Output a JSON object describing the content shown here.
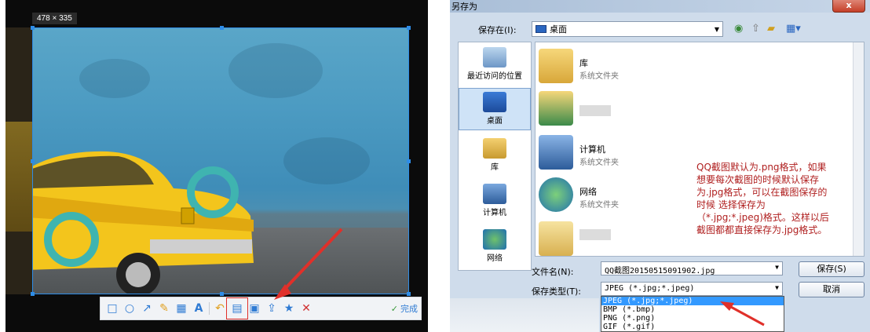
{
  "left": {
    "size_label": "478 × 335",
    "toolbar": {
      "tools": [
        "rect-icon",
        "ellipse-icon",
        "arrow-icon",
        "pen-icon",
        "mosaic-icon",
        "text-icon",
        "undo-icon",
        "save-icon",
        "pin-icon",
        "share-icon",
        "favorite-icon",
        "cancel-icon",
        "done-icon"
      ],
      "done_label": "完成"
    }
  },
  "dialog": {
    "title": "另存为",
    "close_label": "x",
    "save_in_label": "保存在(I):",
    "save_in_value": "桌面",
    "sidebar": [
      {
        "label": "最近访问的位置"
      },
      {
        "label": "桌面"
      },
      {
        "label": "库"
      },
      {
        "label": "计算机"
      },
      {
        "label": "网络"
      }
    ],
    "files": [
      {
        "name": "库",
        "sub": "系统文件夹"
      },
      {
        "name": "",
        "sub": ""
      },
      {
        "name": "计算机",
        "sub": "系统文件夹"
      },
      {
        "name": "网络",
        "sub": "系统文件夹"
      },
      {
        "name": "",
        "sub": ""
      }
    ],
    "note": "QQ截图默认为.png格式，如果想要每次截图的时候默认保存为.jpg格式，可以在截图保存的时候 选择保存为（*.jpg;*.jpeg)格式。这样以后截图都都直接保存为.jpg格式。",
    "filename_label": "文件名(N):",
    "filename_value": "QQ截图20150515091902.jpg",
    "filetype_label": "保存类型(T):",
    "filetype_value": "JPEG (*.jpg;*.jpeg)",
    "save_button": "保存(S)",
    "cancel_button": "取消",
    "type_options": [
      "JPEG (*.jpg;*.jpeg)",
      "BMP (*.bmp)",
      "PNG (*.png)",
      "GIF (*.gif)"
    ]
  }
}
